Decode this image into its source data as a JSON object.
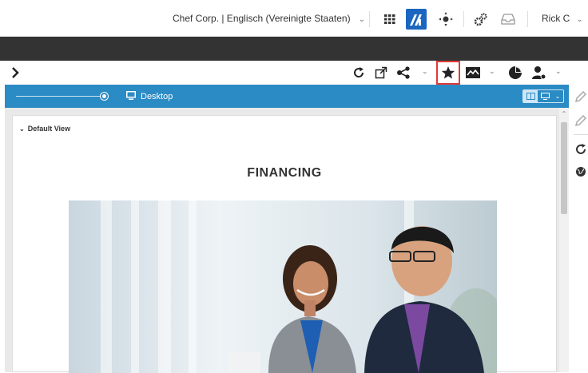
{
  "header": {
    "company_locale": "Chef Corp. | Englisch (Vereinigte Staaten)",
    "user_name": "Rick C",
    "icons": [
      "grid-icon",
      "app-logo-icon",
      "navigation-icon",
      "settings-icon",
      "inbox-icon"
    ]
  },
  "toolbar": {
    "icons": [
      "chevron-right-icon",
      "refresh-icon",
      "external-link-icon",
      "share-icon",
      "favorite-star-icon",
      "compare-image-icon",
      "pie-chart-icon",
      "user-settings-icon"
    ]
  },
  "device_bar": {
    "device_label": "Desktop",
    "preview_slider": 1.0
  },
  "canvas": {
    "view_selector": "Default View",
    "heading": "FINANCING",
    "hero_image": "woman-and-man-in-meeting"
  },
  "colors": {
    "accent_blue": "#2b8bc4",
    "dark_bar": "#333333",
    "highlight_red": "#e03a3a",
    "logo_blue": "#1a66c0"
  }
}
